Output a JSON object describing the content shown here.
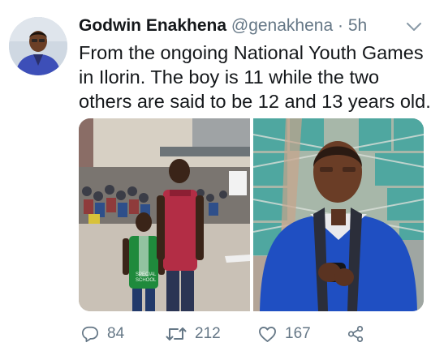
{
  "tweet": {
    "author_name": "Godwin Enakhena",
    "handle": "@genakhena",
    "separator": "·",
    "time": "5h",
    "text_lines": [
      "From the ongoing National Youth Games",
      "in Ilorin. The boy is 11 while the two",
      "others are said to be 12 and 13 years old."
    ]
  },
  "media": {
    "left_shirt_text": [
      "SPECIAL",
      "SCHOOL"
    ]
  },
  "actions": {
    "reply_count": "84",
    "retweet_count": "212",
    "like_count": "167"
  },
  "colors": {
    "text": "#14171a",
    "secondary": "#657786"
  }
}
